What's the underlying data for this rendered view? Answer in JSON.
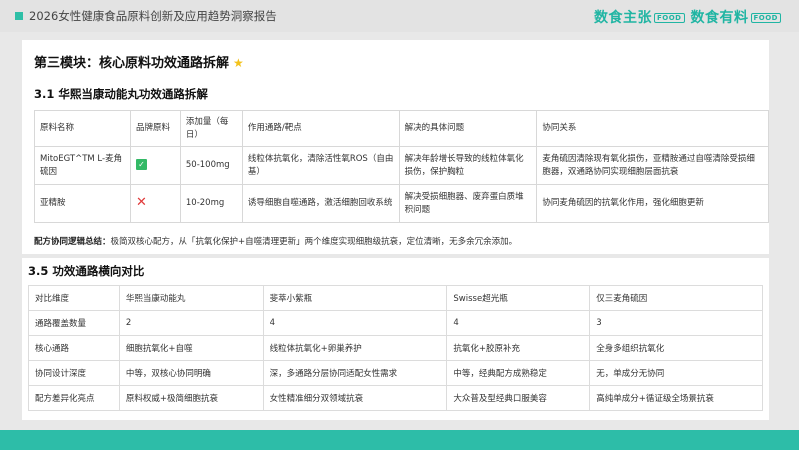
{
  "header": {
    "report_title": "2026女性健康食品原料创新及应用趋势洞察报告",
    "brand_primary": "数食主张",
    "brand_primary_tag": "FOOD",
    "brand_secondary": "数食有料",
    "brand_secondary_tag": "FOOD",
    "accent_color": "#2dbda8"
  },
  "module": {
    "title": "第三模块：核心原料功效通路拆解",
    "title_icon": "star-icon"
  },
  "section_31": {
    "heading": "3.1 华熙当康动能丸功效通路拆解",
    "columns": [
      "原料名称",
      "品牌原料",
      "添加量（每日）",
      "作用通路/靶点",
      "解决的具体问题",
      "协同关系"
    ],
    "rows": [
      {
        "name": "MitoEGT^TM L-麦角硫因",
        "brand_raw": "yes",
        "dose": "50-100mg",
        "pathway": "线粒体抗氧化，清除活性氧ROS（自由基）",
        "problem": "解决年龄增长导致的线粒体氧化损伤，保护胸粒",
        "synergy": "麦角硫因清除现有氧化损伤，亚精胺通过自噬清除受损细胞器，双通路协同实现细胞层面抗衰"
      },
      {
        "name": "亚精胺",
        "brand_raw": "no",
        "dose": "10-20mg",
        "pathway": "诱导细胞自噬通路，激活细胞回收系统",
        "problem": "解决受损细胞器、废弃蛋白质堆积问题",
        "synergy": "协同麦角硫因的抗氧化作用，强化细胞更新"
      }
    ],
    "summary_label": "配方协同逻辑总结：",
    "summary_text": "极简双核心配方，从「抗氧化保护+自噬清理更新」两个维度实现细胞级抗衰，定位清晰，无多余冗余添加。"
  },
  "section_35": {
    "heading": "3.5 功效通路横向对比",
    "columns": [
      "对比维度",
      "华熙当康动能丸",
      "斐萃小紫瓶",
      "Swisse超光瓶",
      "仅三麦角硫因"
    ],
    "rows": [
      [
        "通路覆盖数量",
        "2",
        "4",
        "4",
        "3"
      ],
      [
        "核心通路",
        "细胞抗氧化+自噬",
        "线粒体抗氧化+卵巢养护",
        "抗氧化+胶原补充",
        "全身多组织抗氧化"
      ],
      [
        "协同设计深度",
        "中等，双核心协同明确",
        "深，多通路分层协同适配女性需求",
        "中等，经典配方成熟稳定",
        "无，单成分无协同"
      ],
      [
        "配方差异化亮点",
        "原料权威+极简细胞抗衰",
        "女性精准细分双领域抗衰",
        "大众普及型经典口服美容",
        "高纯单成分+循证级全场景抗衰"
      ]
    ]
  }
}
